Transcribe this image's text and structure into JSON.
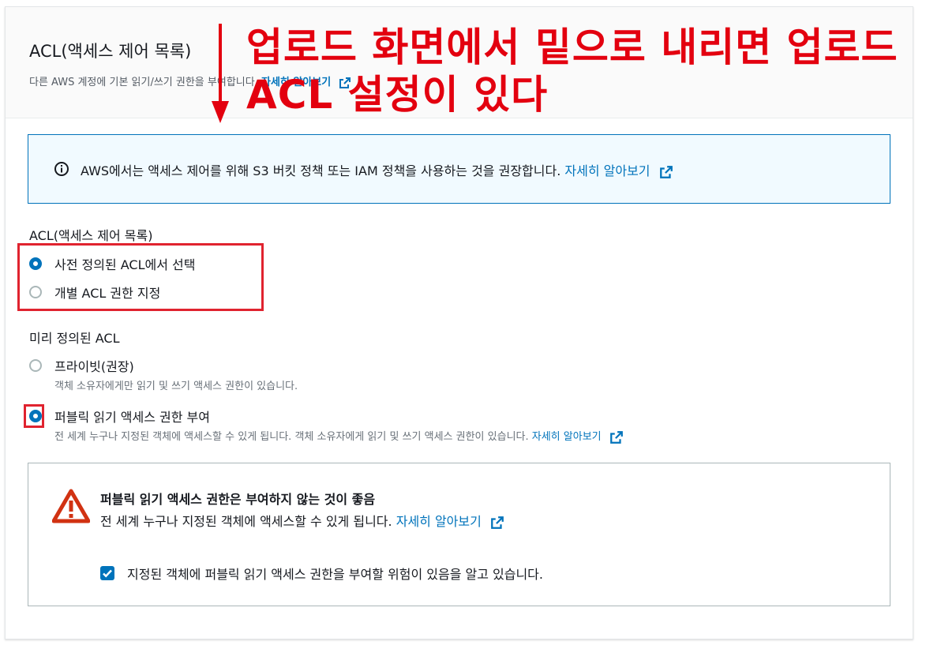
{
  "header": {
    "title": "ACL(액세스 제어 목록)",
    "description": "다른 AWS 계정에 기본 읽기/쓰기 권한을 부여합니다.",
    "learn_more": "자세히 알아보기"
  },
  "annotation": {
    "text": "업로드 화면에서 밑으로 내리면 업로드 ACL 설정이 있다",
    "color": "#e3000f"
  },
  "info": {
    "text": "AWS에서는 액세스 제어를 위해 S3 버킷 정책 또는 IAM 정책을 사용하는 것을 권장합니다.",
    "learn_more": "자세히 알아보기",
    "icon": "info-icon"
  },
  "acl": {
    "label": "ACL(액세스 제어 목록)",
    "options": [
      {
        "label": "사전 정의된 ACL에서 선택",
        "selected": true
      },
      {
        "label": "개별 ACL 권한 지정",
        "selected": false
      }
    ]
  },
  "predefined": {
    "label": "미리 정의된 ACL",
    "options": [
      {
        "label": "프라이빗(권장)",
        "description": "객체 소유자에게만 읽기 및 쓰기 액세스 권한이 있습니다.",
        "selected": false
      },
      {
        "label": "퍼블릭 읽기 액세스 권한 부여",
        "description": "전 세계 누구나 지정된 객체에 액세스할 수 있게 됩니다. 객체 소유자에게 읽기 및 쓰기 액세스 권한이 있습니다.",
        "learn_more": "자세히 알아보기",
        "selected": true
      }
    ]
  },
  "warning": {
    "title": "퍼블릭 읽기 액세스 권한은 부여하지 않는 것이 좋음",
    "description": "전 세계 누구나 지정된 객체에 액세스할 수 있게 됩니다.",
    "learn_more": "자세히 알아보기",
    "ack_label": "지정된 객체에 퍼블릭 읽기 액세스 권한을 부여할 위험이 있음을 알고 있습니다.",
    "ack_checked": true,
    "icon": "warning-icon"
  },
  "colors": {
    "accent": "#0073bb",
    "warning": "#d13212",
    "highlight": "#e0232f"
  }
}
